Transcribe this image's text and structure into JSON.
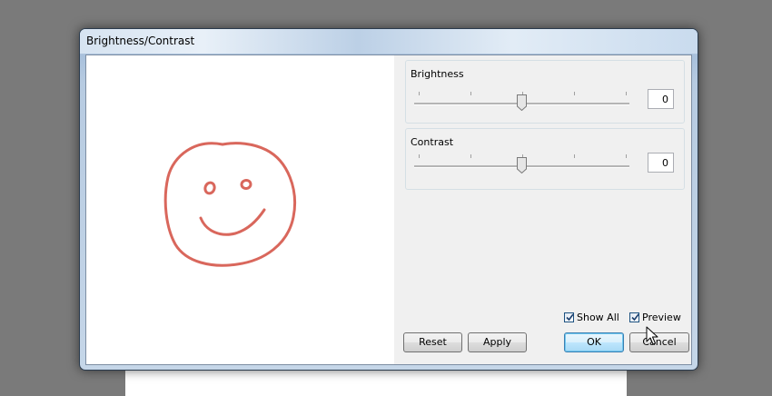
{
  "window": {
    "title": "Brightness/Contrast"
  },
  "brightness": {
    "label": "Brightness",
    "value": "0",
    "slider_position": 0.5
  },
  "contrast": {
    "label": "Contrast",
    "value": "0",
    "slider_position": 0.5
  },
  "options": {
    "show_all": {
      "label": "Show All",
      "checked": true
    },
    "preview": {
      "label": "Preview",
      "checked": true
    }
  },
  "buttons": {
    "reset": "Reset",
    "apply": "Apply",
    "ok": "OK",
    "cancel": "Cancel"
  },
  "icons": {
    "preview_image": "smiley-face-drawing",
    "cursor": "arrow-cursor-icon"
  },
  "colors": {
    "drawing_stroke": "#d9675c",
    "ok_highlight": "#a7d9f5"
  }
}
